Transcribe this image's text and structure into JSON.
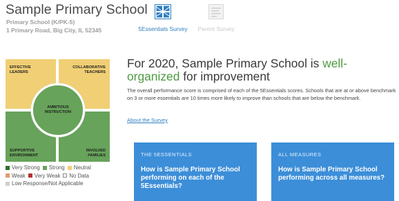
{
  "school": {
    "name": "Sample Primary School",
    "grades": "Primary School (K/PK-5)",
    "address": "1 Primary Road, Big City, IL 52345"
  },
  "survey_tabs": [
    {
      "label": "5Essentials Survey",
      "icon": "5essentials-grid-icon",
      "active": true
    },
    {
      "label": "Parent Survey",
      "icon": "parent-survey-icon",
      "active": false
    }
  ],
  "chart": {
    "quadrants": {
      "effective_leaders": [
        "EFFECTIVE",
        "LEADERS"
      ],
      "collaborative_teachers": [
        "COLLABORATIVE",
        "TEACHERS"
      ],
      "supportive_environment": [
        "SUPPORTIVE",
        "ENVIRONMENT"
      ],
      "involved_families": [
        "INVOLVED",
        "FAMILIES"
      ],
      "ambitious_instruction": [
        "AMBITIOUS",
        "INSTRUCTION"
      ]
    },
    "ratings": {
      "effective_leaders": "Neutral",
      "collaborative_teachers": "Neutral",
      "supportive_environment": "Strong",
      "involved_families": "Strong",
      "ambitious_instruction": "Strong"
    },
    "legend": [
      {
        "label": "Very Strong",
        "color": "#2f6f2f"
      },
      {
        "label": "Strong",
        "color": "#67a35a"
      },
      {
        "label": "Neutral",
        "color": "#f0cf75"
      },
      {
        "label": "Weak",
        "color": "#e39a6b"
      },
      {
        "label": "Very Weak",
        "color": "#b5322c"
      },
      {
        "label": "No Data",
        "color": "#ffffff"
      },
      {
        "label": "Low Response/Not Applicable",
        "color": "#cfcfcf"
      }
    ]
  },
  "headline": {
    "prefix": "For 2020, Sample Primary School is ",
    "rating": "well-organized",
    "suffix": " for improvement"
  },
  "description": "The overall performance score is comprised of each of the 5Essentials scores. Schools that are at or above benchmark on 3 or more essentials are 10 times more likely to improve than schools that are below the benchmark.",
  "about_link": "About the Survey",
  "cards": [
    {
      "kicker": "THE 5ESSENTIALS",
      "question": "How is Sample Primary School performing on each of the 5Essentials?"
    },
    {
      "kicker": "ALL MEASURES",
      "question": "How is Sample Primary School performing across all measures?"
    }
  ],
  "colors": {
    "accent_green": "#4e9a3f",
    "link_blue": "#2f7fc1",
    "card_blue": "#3c8ed8",
    "neutral_yellow": "#f0cf75",
    "strong_green": "#67a35a"
  }
}
